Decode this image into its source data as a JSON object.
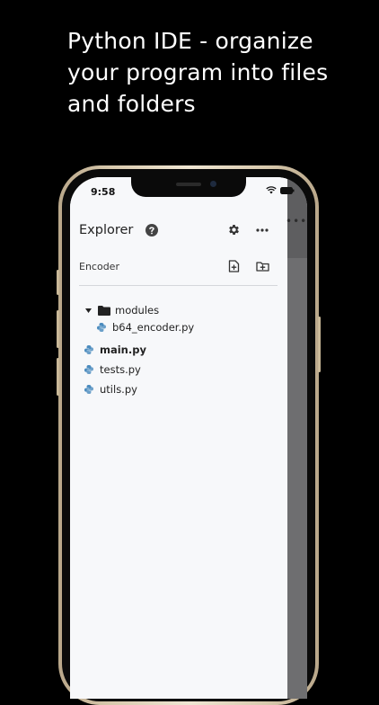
{
  "headline": "Python IDE - organize your program into files and folders",
  "status": {
    "time": "9:58"
  },
  "explorer": {
    "title": "Explorer",
    "folder": "Encoder",
    "tree": {
      "folder_name": "modules",
      "nested_file": "b64_encoder.py",
      "files": [
        "main.py",
        "tests.py",
        "utils.py"
      ]
    }
  },
  "colors": {
    "background": "#000000",
    "panel": "#f7f8fa",
    "python_icon": "#4b8bbe"
  }
}
